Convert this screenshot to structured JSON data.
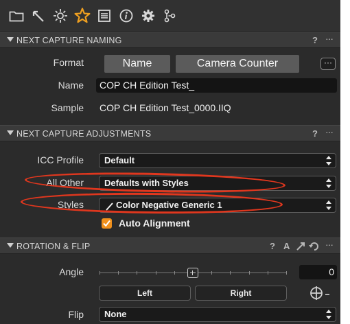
{
  "toolbar": {
    "tools": [
      {
        "icon": "folder-icon"
      },
      {
        "icon": "capture-tool-icon"
      },
      {
        "icon": "sun-adjustments-icon"
      },
      {
        "icon": "star-icon",
        "active": true
      },
      {
        "icon": "list-icon"
      },
      {
        "icon": "info-icon"
      },
      {
        "icon": "gear-icon"
      },
      {
        "icon": "batch-icon"
      }
    ],
    "active_color": "#f0a020"
  },
  "naming": {
    "title": "NEXT CAPTURE NAMING",
    "help": "?",
    "more": "···",
    "format_label": "Format",
    "tokens": [
      "Name",
      "Camera Counter"
    ],
    "token_menu": "···",
    "name_label": "Name",
    "name_value": "COP CH Edition Test_",
    "sample_label": "Sample",
    "sample_value": "COP CH Edition Test_0000.IIQ"
  },
  "adjustments": {
    "title": "NEXT CAPTURE ADJUSTMENTS",
    "help": "?",
    "more": "···",
    "icc_label": "ICC Profile",
    "icc_value": "Default",
    "allother_label": "All Other",
    "allother_value": "Defaults with Styles",
    "styles_label": "Styles",
    "styles_value": "Color Negative Generic 1",
    "auto_align_label": "Auto Alignment",
    "auto_align_checked": true,
    "highlight_color": "#e0371e"
  },
  "rotation": {
    "title": "ROTATION & FLIP",
    "help": "?",
    "auto": "A",
    "more": "···",
    "angle_label": "Angle",
    "angle_value": "0",
    "angle_slider": 0.5,
    "left_button": "Left",
    "right_button": "Right",
    "flip_label": "Flip",
    "flip_value": "None"
  }
}
